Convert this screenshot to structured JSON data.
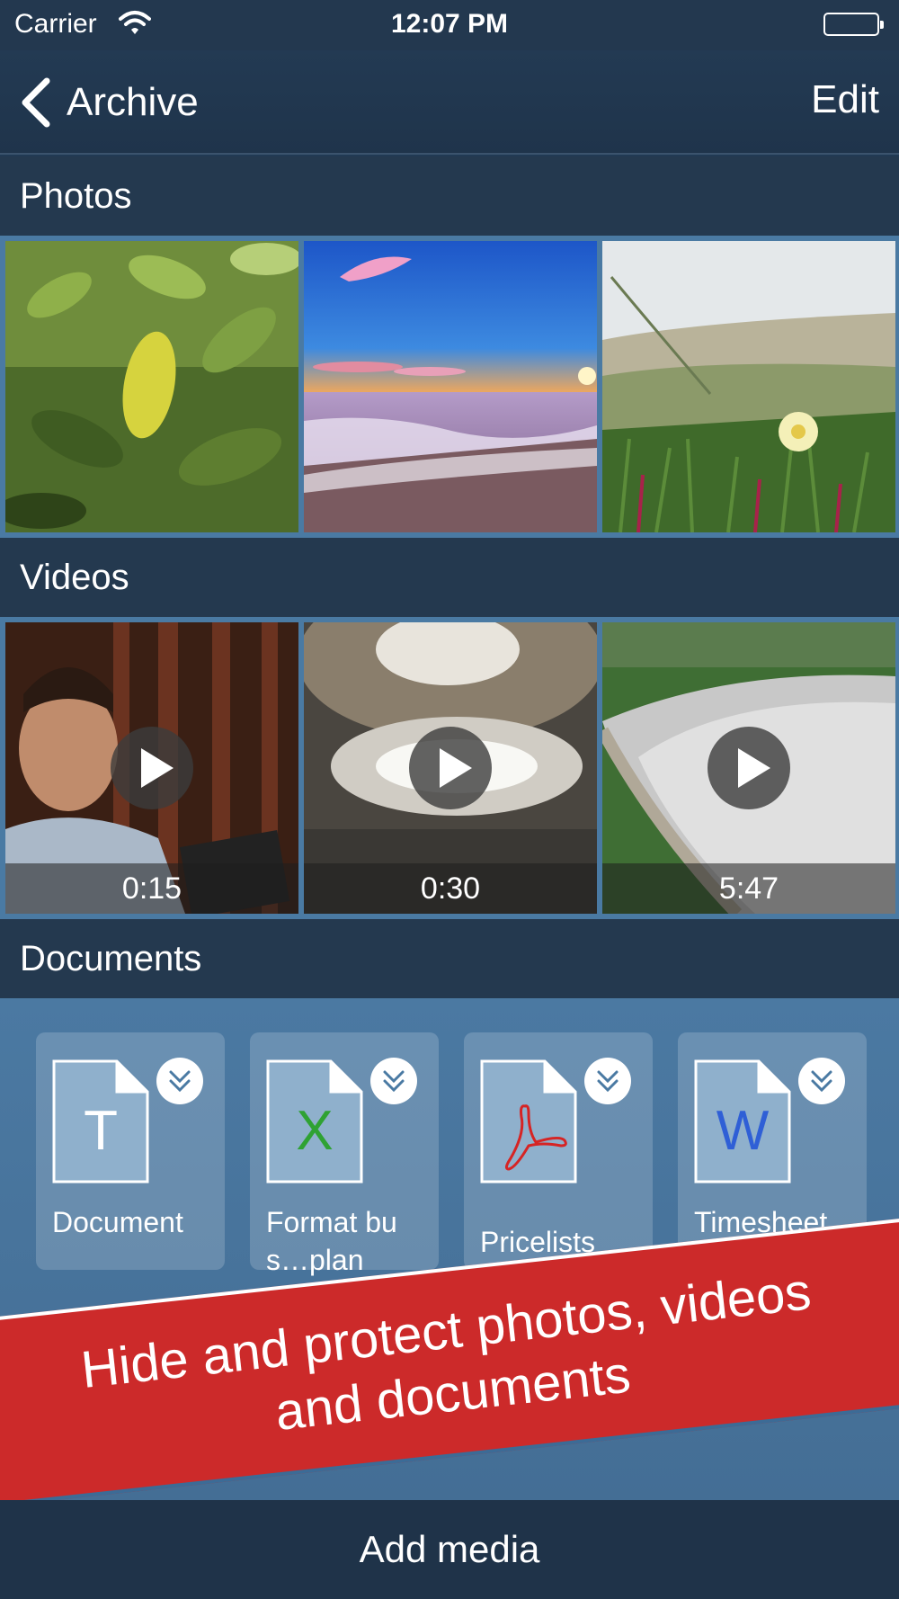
{
  "status_bar": {
    "carrier": "Carrier",
    "time": "12:07 PM",
    "wifi_icon": "wifi-icon",
    "battery_icon": "battery-icon"
  },
  "nav": {
    "back_label": "Archive",
    "edit_label": "Edit"
  },
  "sections": {
    "photos": "Photos",
    "videos": "Videos",
    "documents": "Documents"
  },
  "photos": [
    {
      "subject": "green-leaves"
    },
    {
      "subject": "beach-sunset"
    },
    {
      "subject": "dune-flower"
    }
  ],
  "videos": [
    {
      "duration": "0:15"
    },
    {
      "duration": "0:30"
    },
    {
      "duration": "5:47"
    }
  ],
  "documents": [
    {
      "name": "Document",
      "letter": "T",
      "letter_color": "#ffffff"
    },
    {
      "name": "Format bus…plan",
      "letter": "X",
      "letter_color": "#2fa233"
    },
    {
      "name": "Pricelists",
      "letter": "",
      "letter_color": "#d62424"
    },
    {
      "name": "Timesheet",
      "letter": "W",
      "letter_color": "#2f5fd6"
    }
  ],
  "promo": {
    "line1": "Hide and protect photos, videos",
    "line2": "and documents"
  },
  "bottom_bar": {
    "add_label": "Add media"
  },
  "colors": {
    "background": "#213a54",
    "tile_border": "#4a7aa3",
    "banner_red": "#cc2a2a"
  }
}
